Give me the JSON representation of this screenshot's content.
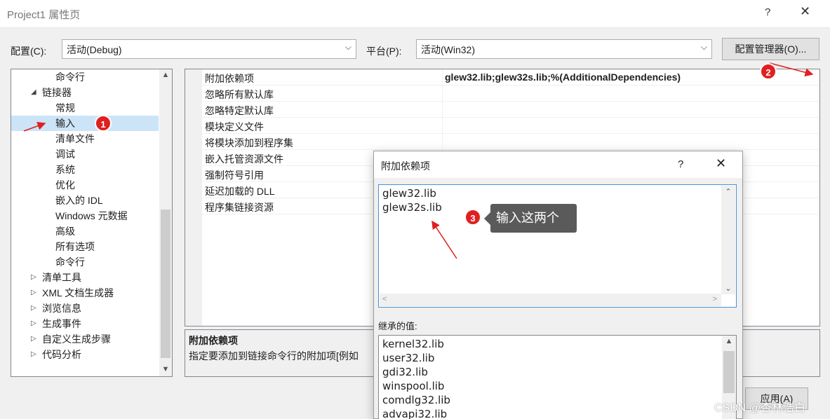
{
  "window": {
    "title": "Project1 属性页",
    "help": "?",
    "close": "✕"
  },
  "config": {
    "label": "配置(C):",
    "value": "活动(Debug)"
  },
  "platform": {
    "label": "平台(P):",
    "value": "活动(Win32)"
  },
  "config_manager": "配置管理器(O)...",
  "tree": [
    {
      "label": "命令行",
      "level": 2
    },
    {
      "label": "链接器",
      "level": 1,
      "expander": "◢"
    },
    {
      "label": "常规",
      "level": 2
    },
    {
      "label": "输入",
      "level": 2,
      "selected": true
    },
    {
      "label": "清单文件",
      "level": 2
    },
    {
      "label": "调试",
      "level": 2
    },
    {
      "label": "系统",
      "level": 2
    },
    {
      "label": "优化",
      "level": 2
    },
    {
      "label": "嵌入的 IDL",
      "level": 2
    },
    {
      "label": "Windows 元数据",
      "level": 2
    },
    {
      "label": "高级",
      "level": 2
    },
    {
      "label": "所有选项",
      "level": 2
    },
    {
      "label": "命令行",
      "level": 2
    },
    {
      "label": "清单工具",
      "level": 1,
      "expander": "▷"
    },
    {
      "label": "XML 文档生成器",
      "level": 1,
      "expander": "▷"
    },
    {
      "label": "浏览信息",
      "level": 1,
      "expander": "▷"
    },
    {
      "label": "生成事件",
      "level": 1,
      "expander": "▷"
    },
    {
      "label": "自定义生成步骤",
      "level": 1,
      "expander": "▷"
    },
    {
      "label": "代码分析",
      "level": 1,
      "expander": "▷"
    }
  ],
  "properties": [
    {
      "name": "附加依赖项",
      "value": "glew32.lib;glew32s.lib;%(AdditionalDependencies)"
    },
    {
      "name": "忽略所有默认库",
      "value": ""
    },
    {
      "name": "忽略特定默认库",
      "value": ""
    },
    {
      "name": "模块定义文件",
      "value": ""
    },
    {
      "name": "将模块添加到程序集",
      "value": ""
    },
    {
      "name": "嵌入托管资源文件",
      "value": ""
    },
    {
      "name": "强制符号引用",
      "value": ""
    },
    {
      "name": "延迟加载的 DLL",
      "value": ""
    },
    {
      "name": "程序集链接资源",
      "value": ""
    }
  ],
  "description": {
    "heading": "附加依赖项",
    "text": "指定要添加到链接命令行的附加项[例如"
  },
  "apply": "应用(A)",
  "dialog": {
    "title": "附加依赖项",
    "help": "?",
    "close": "✕",
    "lines": [
      "glew32.lib",
      "glew32s.lib"
    ],
    "inherited_label": "继承的值:",
    "inherited": [
      "kernel32.lib",
      "user32.lib",
      "gdi32.lib",
      "winspool.lib",
      "comdlg32.lib",
      "advapi32.lib"
    ]
  },
  "annotations": {
    "badge1": "1",
    "badge2": "2",
    "badge3": "3",
    "tooltip": "输入这两个",
    "arrow_color": "#e02020"
  },
  "watermark": "CSDN @杏林浩白"
}
